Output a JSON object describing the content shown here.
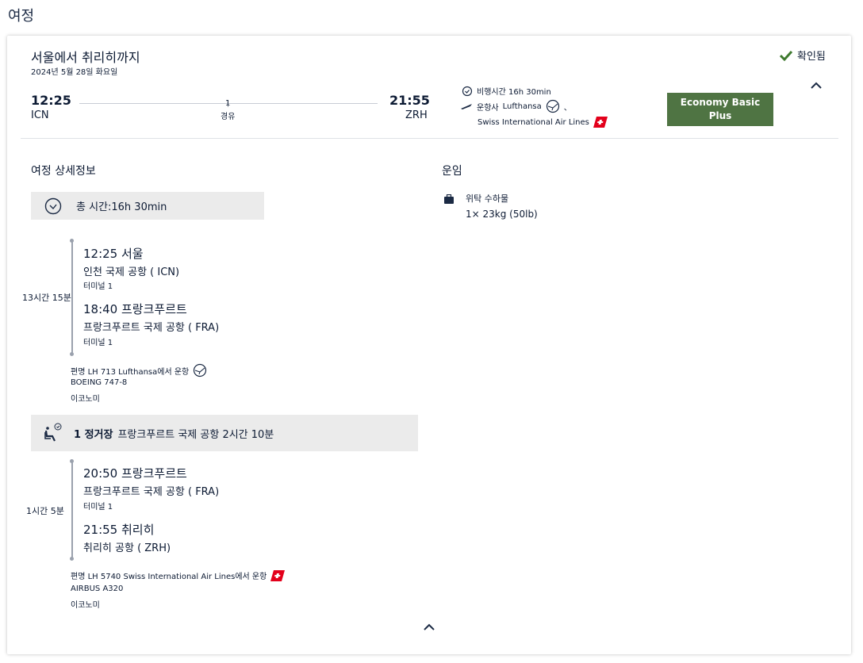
{
  "page_title": "여정",
  "summary": {
    "route_title": "서울에서 취리히까지",
    "date": "2024년 5월 28일 화요일",
    "status": "확인됨",
    "departure_time": "12:25",
    "departure_code": "ICN",
    "stops_count": "1",
    "stops_label": "경유",
    "arrival_time": "21:55",
    "arrival_code": "ZRH",
    "flight_time": "비행시간 16h 30min",
    "operator_prefix": "운항사",
    "operator_1": "Lufthansa",
    "separator": "、",
    "operator_2": "Swiss International Air Lines",
    "cabin_line1": "Economy Basic",
    "cabin_line2": "Plus"
  },
  "details": {
    "heading": "여정 상세정보",
    "total_time": "총 시간:16h 30min",
    "segments": [
      {
        "duration": "13시간 15분",
        "dep_time_city": "12:25 서울",
        "dep_airport": "인천 국제 공항 ( ICN)",
        "dep_terminal": "터미널 1",
        "arr_time_city": "18:40 프랑크푸르트",
        "arr_airport": "프랑크푸르트 국제 공항 ( FRA)",
        "arr_terminal": "터미널 1",
        "flight": "편명 LH 713 Lufthansa에서 운항",
        "aircraft": "BOEING 747-8",
        "cabin": "이코노미"
      },
      {
        "duration": "1시간 5분",
        "dep_time_city": "20:50 프랑크푸르트",
        "dep_airport": "프랑크푸르트 국제 공항 ( FRA)",
        "dep_terminal": "터미널 1",
        "arr_time_city": "21:55 취리히",
        "arr_airport": "취리히 공항 ( ZRH)",
        "flight": "편명 LH 5740 Swiss International Air Lines에서 운항",
        "aircraft": "AIRBUS A320",
        "cabin": "이코노미"
      }
    ],
    "layover_bold": "1 정거장",
    "layover_text": "프랑크푸르트 국제 공항 2시간 10분"
  },
  "fare": {
    "heading": "운임",
    "baggage_label": "위탁 수하물",
    "baggage_value": "1× 23kg (50lb)"
  },
  "colors": {
    "cabin_green": "#4f7443",
    "confirmed_green": "#3f7a2f",
    "swiss_red": "#e3001b",
    "text_navy": "#0c1a33"
  },
  "icons": [
    "check-icon",
    "chevron-up-icon",
    "clock-icon",
    "plane-icon",
    "lufthansa-logo-icon",
    "swiss-logo-icon",
    "suitcase-icon",
    "seat-clock-icon"
  ]
}
